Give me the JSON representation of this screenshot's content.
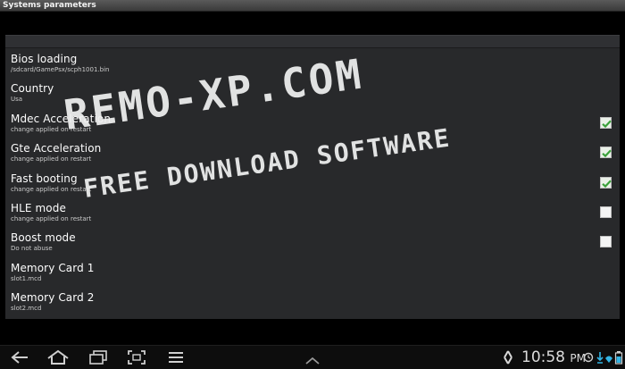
{
  "window": {
    "title": "Systems parameters"
  },
  "settings": [
    {
      "label": "Bios loading",
      "summary": "/sdcard/GamePsx/scph1001.bin",
      "checkbox": null
    },
    {
      "label": "Country",
      "summary": "Usa",
      "checkbox": null
    },
    {
      "label": "Mdec Acceleration",
      "summary": "change applied on restart",
      "checkbox": true
    },
    {
      "label": "Gte Acceleration",
      "summary": "change applied on restart",
      "checkbox": true
    },
    {
      "label": "Fast booting",
      "summary": "change applied on restart",
      "checkbox": true
    },
    {
      "label": "HLE mode",
      "summary": "change applied on restart",
      "checkbox": false
    },
    {
      "label": "Boost mode",
      "summary": "Do not abuse",
      "checkbox": false
    },
    {
      "label": "Memory Card 1",
      "summary": "slot1.mcd",
      "checkbox": null
    },
    {
      "label": "Memory Card 2",
      "summary": "slot2.mcd",
      "checkbox": null
    }
  ],
  "watermark": {
    "line1": "REMO-XP.COM",
    "line2": "FREE DOWNLOAD SOFTWARE"
  },
  "statusbar": {
    "time": "10:58",
    "ampm": "PM"
  },
  "navbar": {
    "icons": [
      "back-icon",
      "home-icon",
      "recent-apps-icon",
      "screenshot-icon",
      "menu-icon",
      "chevron-up-icon",
      "recycle-icon",
      "alarm-icon",
      "download-icon",
      "wifi-icon",
      "battery-icon"
    ]
  },
  "colors": {
    "panel": "#28292b",
    "accent_check": "#3aa03a",
    "background": "#000000"
  }
}
